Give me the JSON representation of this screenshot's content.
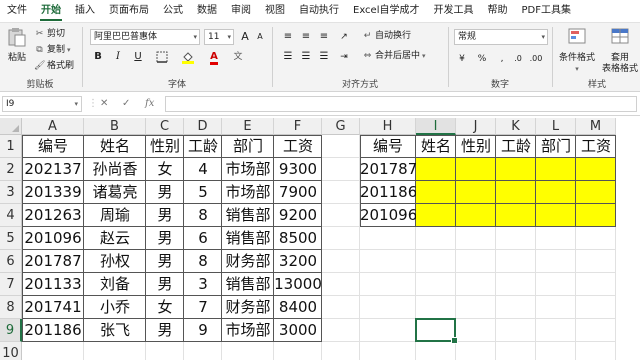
{
  "menu": [
    "文件",
    "开始",
    "插入",
    "页面布局",
    "公式",
    "数据",
    "审阅",
    "视图",
    "自动执行",
    "Excel自学成才",
    "开发工具",
    "帮助",
    "PDF工具集"
  ],
  "active_menu_index": 1,
  "ribbon": {
    "clipboard": {
      "paste": "粘贴",
      "cut": "剪切",
      "copy": "复制",
      "format_painter": "格式刷",
      "label": "剪贴板"
    },
    "font": {
      "name": "阿里巴巴普惠体",
      "size": "11",
      "bold": "B",
      "italic": "I",
      "underline": "U",
      "grow": "A",
      "shrink": "A",
      "font_color_glyph": "A",
      "label": "字体"
    },
    "alignment": {
      "wrap": "自动换行",
      "merge": "合并后居中",
      "label": "对齐方式"
    },
    "number": {
      "format": "常规",
      "label": "数字"
    },
    "styles": {
      "conditional": "条件格式",
      "table_format_line1": "套用",
      "table_format_line2": "表格格式",
      "label": "样式"
    }
  },
  "formula_bar": {
    "name_box": "I9",
    "cancel": "✕",
    "confirm": "✓",
    "fx": "fx",
    "formula": ""
  },
  "grid": {
    "columns": [
      "A",
      "B",
      "C",
      "D",
      "E",
      "F",
      "G",
      "H",
      "I",
      "J",
      "K",
      "L",
      "M"
    ],
    "rows": [
      "1",
      "2",
      "3",
      "4",
      "5",
      "6",
      "7",
      "8",
      "9",
      "10"
    ],
    "selected_column": "I",
    "selected_row": "9",
    "left_table": {
      "headers": [
        "编号",
        "姓名",
        "性别",
        "工龄",
        "部门",
        "工资"
      ],
      "rows": [
        [
          "202137",
          "孙尚香",
          "女",
          "4",
          "市场部",
          "9300"
        ],
        [
          "201339",
          "诸葛亮",
          "男",
          "5",
          "市场部",
          "7900"
        ],
        [
          "201263",
          "周瑜",
          "男",
          "8",
          "销售部",
          "9200"
        ],
        [
          "201096",
          "赵云",
          "男",
          "6",
          "销售部",
          "8500"
        ],
        [
          "201787",
          "孙权",
          "男",
          "8",
          "财务部",
          "3200"
        ],
        [
          "201133",
          "刘备",
          "男",
          "3",
          "销售部",
          "13000"
        ],
        [
          "201741",
          "小乔",
          "女",
          "7",
          "财务部",
          "8400"
        ],
        [
          "201186",
          "张飞",
          "男",
          "9",
          "市场部",
          "3000"
        ]
      ]
    },
    "right_table": {
      "headers": [
        "编号",
        "姓名",
        "性别",
        "工龄",
        "部门",
        "工资"
      ],
      "ids": [
        "201787",
        "201186",
        "201096"
      ],
      "fill_color": "#ffff00"
    }
  },
  "colors": {
    "accent": "#217346",
    "header_bg": "#f0f0f0",
    "ribbon_bg": "#f3f3f3"
  }
}
